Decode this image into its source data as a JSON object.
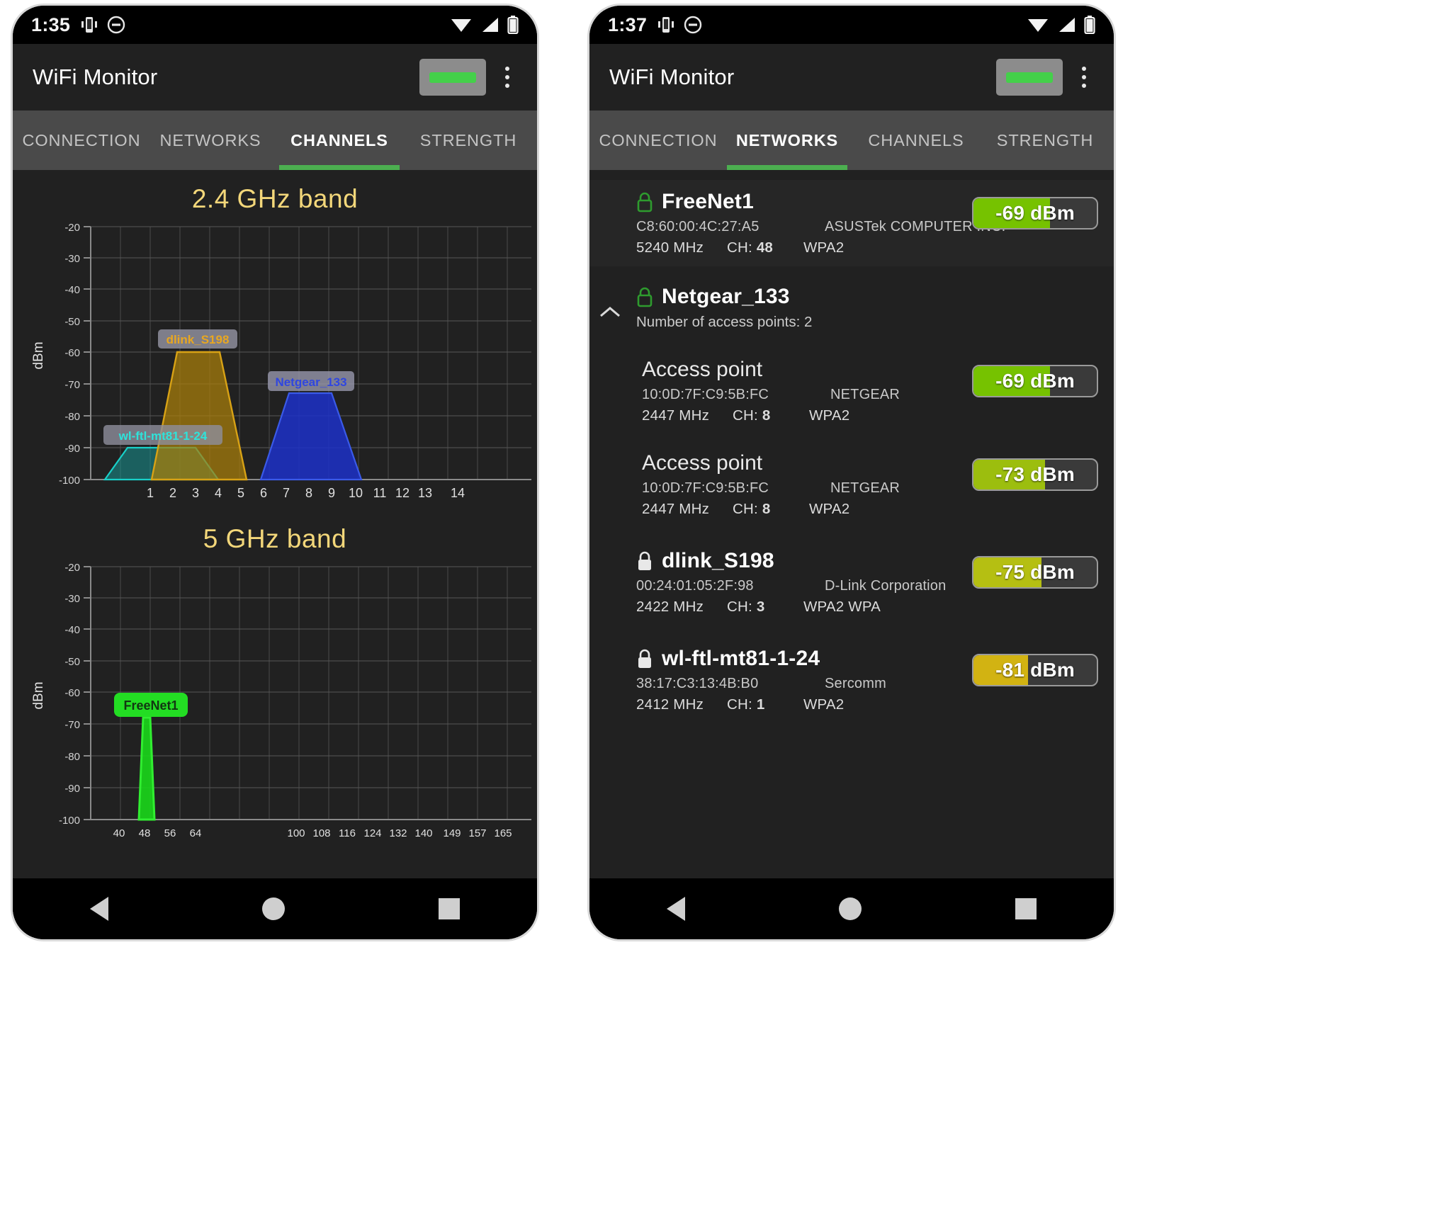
{
  "app": {
    "title": "WiFi Monitor"
  },
  "phones": [
    {
      "status": {
        "time": "1:35"
      },
      "active_tab": "CHANNELS"
    },
    {
      "status": {
        "time": "1:37"
      },
      "active_tab": "NETWORKS"
    }
  ],
  "tabs": [
    {
      "label": "CONNECTION"
    },
    {
      "label": "NETWORKS"
    },
    {
      "label": "CHANNELS"
    },
    {
      "label": "STRENGTH"
    }
  ],
  "channels_screen": {
    "band24_title": "2.4 GHz band",
    "band5_title": "5 GHz band",
    "axis_label": "dBm"
  },
  "networks_screen": {
    "items": [
      {
        "kind": "network",
        "ssid": "FreeNet1",
        "locked": true,
        "bssid": "C8:60:00:4C:27:A5",
        "vendor": "ASUSTek COMPUTER INC.",
        "freq": "5240 MHz",
        "channel_label": "CH:",
        "channel": "48",
        "security": "WPA2",
        "dbm": "-69 dBm",
        "dbm_value": -69,
        "fill_color": "#76c200",
        "shaded": true,
        "expandable": false
      },
      {
        "kind": "group",
        "ssid": "Netgear_133",
        "locked": true,
        "ap_count_text": "Number of access points: 2",
        "expandable": true,
        "shaded": false,
        "children": [
          {
            "kind": "access_point",
            "title": "Access point",
            "bssid": "10:0D:7F:C9:5B:FC",
            "vendor": "NETGEAR",
            "freq": "2447 MHz",
            "channel_label": "CH:",
            "channel": "8",
            "security": "WPA2",
            "dbm": "-69 dBm",
            "dbm_value": -69,
            "fill_color": "#76c200"
          },
          {
            "kind": "access_point",
            "title": "Access point",
            "bssid": "10:0D:7F:C9:5B:FC",
            "vendor": "NETGEAR",
            "freq": "2447 MHz",
            "channel_label": "CH:",
            "channel": "8",
            "security": "WPA2",
            "dbm": "-73 dBm",
            "dbm_value": -73,
            "fill_color": "#9cbe0e"
          }
        ]
      },
      {
        "kind": "network",
        "ssid": "dlink_S198",
        "locked": true,
        "bssid": "00:24:01:05:2F:98",
        "vendor": "D-Link Corporation",
        "freq": "2422 MHz",
        "channel_label": "CH:",
        "channel": "3",
        "security": "WPA2 WPA",
        "dbm": "-75 dBm",
        "dbm_value": -75,
        "fill_color": "#b5bf12",
        "shaded": false,
        "expandable": false
      },
      {
        "kind": "network",
        "ssid": "wl-ftl-mt81-1-24",
        "locked": true,
        "bssid": "38:17:C3:13:4B:B0",
        "vendor": "Sercomm",
        "freq": "2412 MHz",
        "channel_label": "CH:",
        "channel": "1",
        "security": "WPA2",
        "dbm": "-81 dBm",
        "dbm_value": -81,
        "fill_color": "#d2b312",
        "shaded": false,
        "expandable": false
      }
    ]
  },
  "chart_data": [
    {
      "type": "area",
      "title": "2.4 GHz band",
      "xlabel": "",
      "ylabel": "dBm",
      "ylim": [
        -100,
        -20
      ],
      "yticks": [
        -20,
        -30,
        -40,
        -50,
        -60,
        -70,
        -80,
        -90,
        -100
      ],
      "xticks": [
        1,
        2,
        3,
        4,
        5,
        6,
        7,
        8,
        9,
        10,
        11,
        12,
        13,
        14
      ],
      "grid": true,
      "legend": "inline-labels",
      "series": [
        {
          "name": "wl-ftl-mt81-1-24",
          "center_channel": 1,
          "peak_dbm": -90,
          "color": "#19d0c8",
          "fill": "rgba(24,160,155,0.55)",
          "label_color": "#2ee3da",
          "span_channels": [
            -1.5,
            3.5
          ]
        },
        {
          "name": "dlink_S198",
          "center_channel": 3,
          "peak_dbm": -60,
          "color": "#d8a215",
          "fill": "rgba(176,132,12,0.70)",
          "label_color": "#e8a721",
          "span_channels": [
            0.5,
            5.5
          ]
        },
        {
          "name": "Netgear_133",
          "center_channel": 8,
          "peak_dbm": -73,
          "color": "#2f4fd4",
          "fill": "rgba(26,49,200,0.78)",
          "label_color": "#2f46e0",
          "span_channels": [
            5.5,
            10.5
          ]
        }
      ]
    },
    {
      "type": "area",
      "title": "5 GHz band",
      "xlabel": "",
      "ylabel": "dBm",
      "ylim": [
        -100,
        -20
      ],
      "yticks": [
        -20,
        -30,
        -40,
        -50,
        -60,
        -70,
        -80,
        -90,
        -100
      ],
      "xticks": [
        40,
        48,
        56,
        64,
        100,
        108,
        116,
        124,
        132,
        140,
        149,
        157,
        165
      ],
      "grid": true,
      "legend": "inline-labels",
      "series": [
        {
          "name": "FreeNet1",
          "center_channel": 48,
          "peak_dbm": -68,
          "color": "#20e020",
          "fill": "rgba(20,200,20,0.82)",
          "label_color": "#101510",
          "label_bg": "#22dd22"
        }
      ]
    }
  ]
}
